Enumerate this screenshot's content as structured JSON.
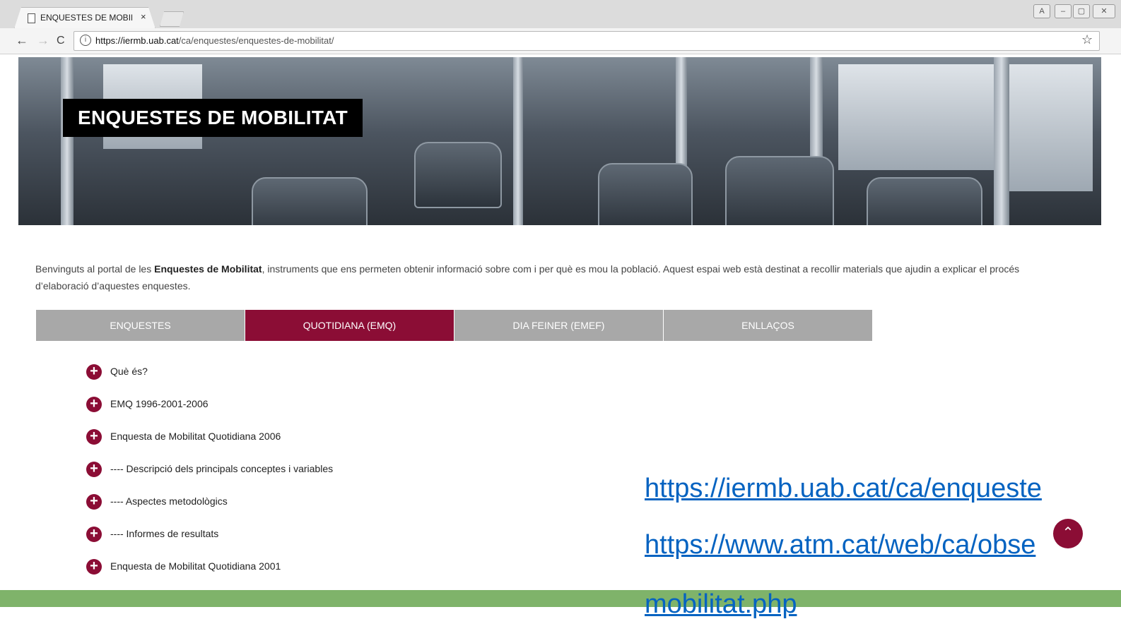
{
  "browser": {
    "tab_title": "ENQUESTES DE MOBILITAT",
    "tab_close": "×",
    "url_host": "https://iermb.uab.cat",
    "url_path": "/ca/enquestes/enquestes-de-mobilitat/",
    "back": "←",
    "forward": "→",
    "reload": "C",
    "info": "i",
    "star": "☆",
    "win_user": "A",
    "win_min": "–",
    "win_max": "▢"
  },
  "hero": {
    "title": "ENQUESTES DE MOBILITAT"
  },
  "intro": {
    "before": "Benvinguts al portal de les ",
    "bold": "Enquestes de Mobilitat",
    "after": ", instruments que ens permeten obtenir informació sobre com i per què es mou la població. Aquest espai web està destinat a recollir materials que ajudin a explicar el procés d’elaboració d’aquestes enquestes."
  },
  "tabs": [
    {
      "label": "ENQUESTES"
    },
    {
      "label": "QUOTIDIANA (EMQ)"
    },
    {
      "label": "DIA FEINER (EMEF)"
    },
    {
      "label": "ENLLAÇOS"
    }
  ],
  "accordion": [
    {
      "label": "Què és?"
    },
    {
      "label": "EMQ 1996-2001-2006"
    },
    {
      "label": "Enquesta de Mobilitat Quotidiana 2006"
    },
    {
      "label": "---- Descripció dels principals conceptes i variables"
    },
    {
      "label": "---- Aspectes metodològics"
    },
    {
      "label": "---- Informes de resultats"
    },
    {
      "label": "Enquesta de Mobilitat Quotidiana 2001"
    }
  ],
  "overlay_links": {
    "link1": "https://iermb.uab.cat/ca/enqueste",
    "link2": "https://www.atm.cat/web/ca/obse",
    "link2_tail": "mobilitat.php"
  },
  "plus_glyph": "+",
  "totop_glyph": "⌃"
}
